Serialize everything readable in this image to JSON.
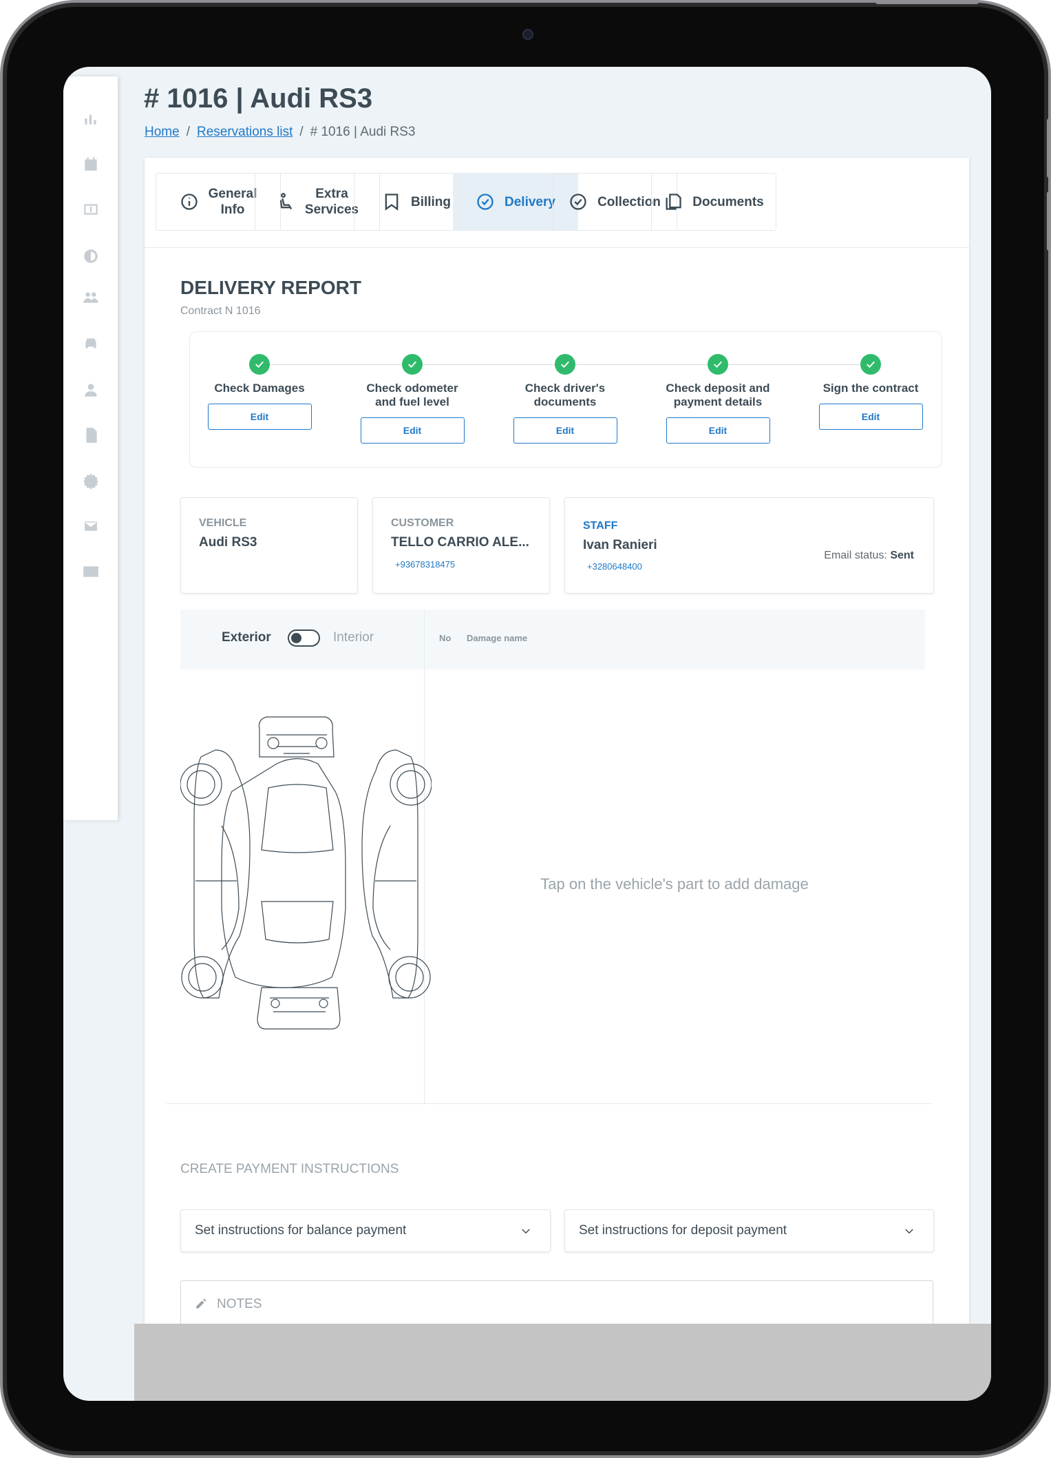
{
  "page": {
    "title": "# 1016 | Audi RS3"
  },
  "breadcrumb": {
    "home": "Home",
    "sep1": "/",
    "reservations": "Reservations list",
    "sep2": "/",
    "current": "# 1016 | Audi RS3"
  },
  "tabs": [
    {
      "line1": "General",
      "line2": "Info",
      "icon": "info-icon"
    },
    {
      "line1": "Extra",
      "line2": "Services",
      "icon": "child-seat-icon"
    },
    {
      "line1": "Billing",
      "line2": "",
      "icon": "receipt-icon"
    },
    {
      "line1": "Delivery",
      "line2": "",
      "icon": "check-circle-icon",
      "active": true
    },
    {
      "line1": "Collection",
      "line2": "",
      "icon": "check-circle-icon"
    },
    {
      "line1": "Documents",
      "line2": "",
      "icon": "documents-icon"
    }
  ],
  "report": {
    "title": "DELIVERY REPORT",
    "contract": "Contract N 1016"
  },
  "steps": [
    {
      "line1": "Check Damages",
      "line2": "",
      "edit": "Edit"
    },
    {
      "line1": "Check odometer",
      "line2": "and fuel level",
      "edit": "Edit"
    },
    {
      "line1": "Check driver's",
      "line2": "documents",
      "edit": "Edit"
    },
    {
      "line1": "Check deposit and",
      "line2": "payment details",
      "edit": "Edit"
    },
    {
      "line1": "Sign the contract",
      "line2": "",
      "edit": "Edit"
    }
  ],
  "vehicle": {
    "label": "VEHICLE",
    "value": "Audi RS3"
  },
  "customer": {
    "label": "CUSTOMER",
    "value": "TELLO CARRIO ALE...",
    "phone": "+93678318475"
  },
  "staff": {
    "label": "STAFF",
    "value": "Ivan Ranieri",
    "phone": "+3280648400",
    "email_label": "Email status:",
    "email_value": "Sent"
  },
  "damage": {
    "exterior": "Exterior",
    "interior": "Interior",
    "col_no": "No",
    "col_name": "Damage name",
    "hint": "Tap on the vehicle's part to add damage"
  },
  "payment": {
    "title": "CREATE PAYMENT INSTRUCTIONS",
    "balance": "Set instructions for balance payment",
    "deposit": "Set instructions for deposit payment"
  },
  "notes": {
    "placeholder": "NOTES"
  },
  "colors": {
    "accent": "#1f78c8",
    "success": "#2fbb6b",
    "text": "#3d4b55",
    "muted": "#9aa4ab"
  }
}
